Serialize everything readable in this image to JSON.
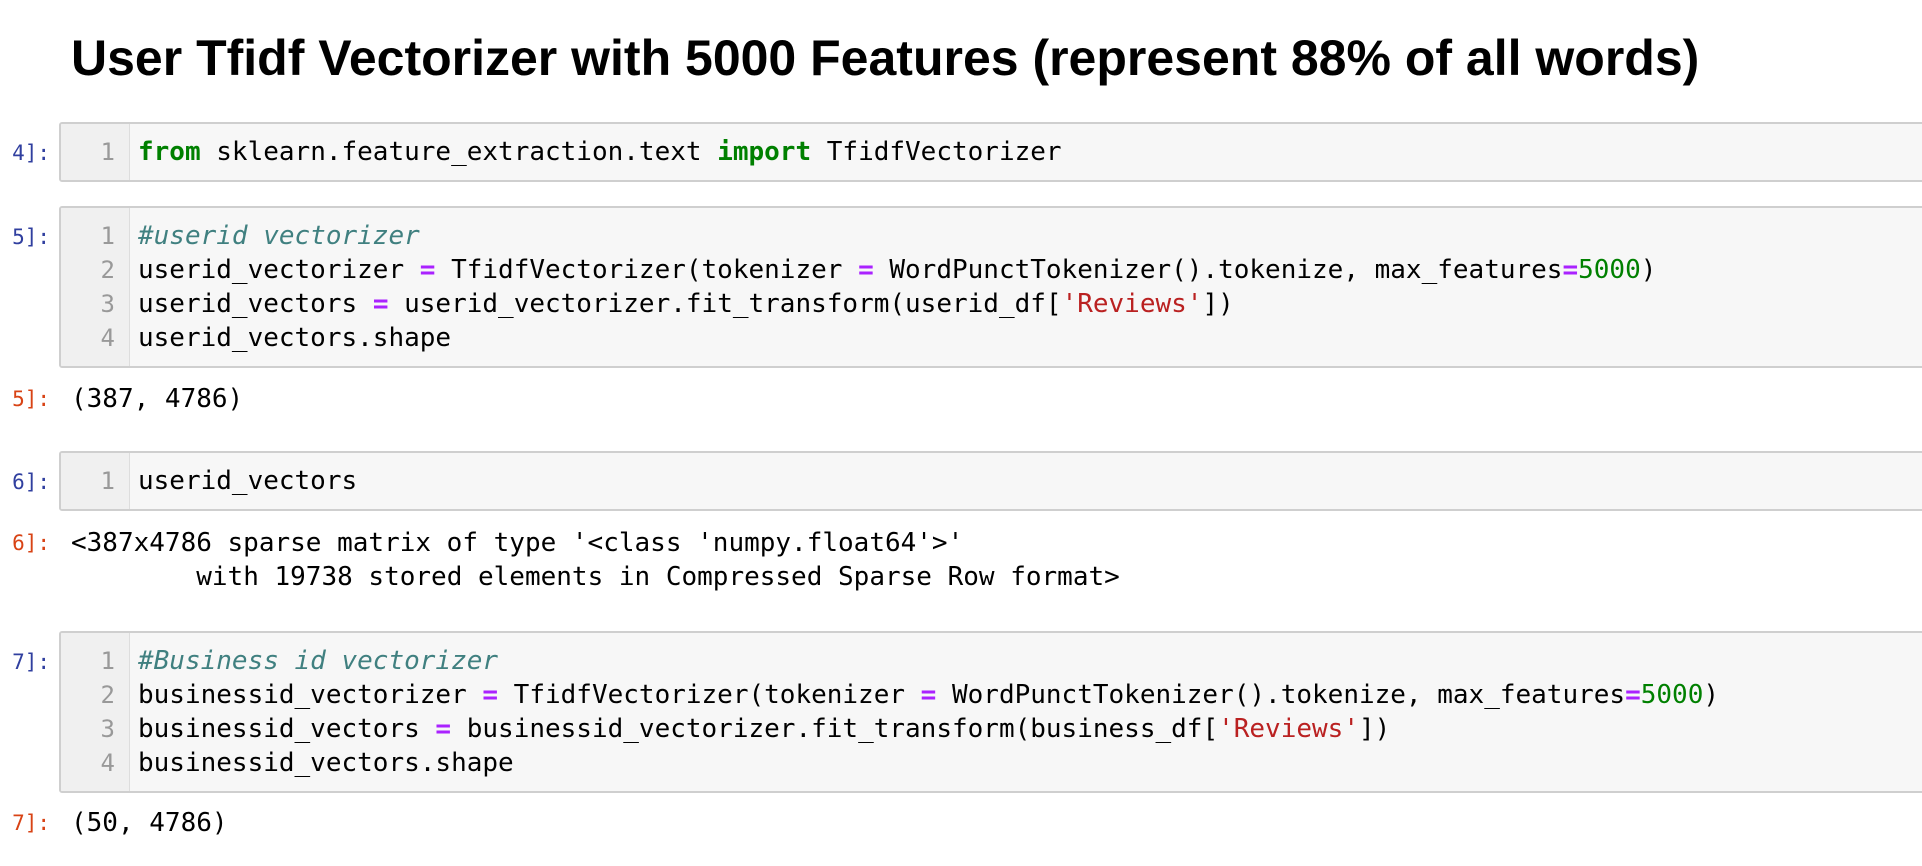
{
  "heading": "User Tfidf Vectorizer with 5000 Features (represent 88% of all words)",
  "cells": [
    {
      "in_prompt": "4]:",
      "lines": [
        {
          "n": "1",
          "tokens": [
            {
              "t": "from",
              "c": "kw"
            },
            {
              "t": " sklearn.feature_extraction.text ",
              "c": ""
            },
            {
              "t": "import",
              "c": "kw"
            },
            {
              "t": " TfidfVectorizer",
              "c": ""
            }
          ]
        }
      ]
    },
    {
      "in_prompt": "5]:",
      "lines": [
        {
          "n": "1",
          "tokens": [
            {
              "t": "#userid vectorizer",
              "c": "cm"
            }
          ]
        },
        {
          "n": "2",
          "tokens": [
            {
              "t": "userid_vectorizer ",
              "c": ""
            },
            {
              "t": "=",
              "c": "op"
            },
            {
              "t": " TfidfVectorizer(tokenizer ",
              "c": ""
            },
            {
              "t": "=",
              "c": "op"
            },
            {
              "t": " WordPunctTokenizer().tokenize, max_features",
              "c": ""
            },
            {
              "t": "=",
              "c": "op"
            },
            {
              "t": "5000",
              "c": "num"
            },
            {
              "t": ")",
              "c": ""
            }
          ]
        },
        {
          "n": "3",
          "tokens": [
            {
              "t": "userid_vectors ",
              "c": ""
            },
            {
              "t": "=",
              "c": "op"
            },
            {
              "t": " userid_vectorizer.fit_transform(userid_df[",
              "c": ""
            },
            {
              "t": "'Reviews'",
              "c": "str"
            },
            {
              "t": "])",
              "c": ""
            }
          ]
        },
        {
          "n": "4",
          "tokens": [
            {
              "t": "userid_vectors.shape",
              "c": ""
            }
          ]
        }
      ],
      "out_prompt": "5]:",
      "output": "(387, 4786)"
    },
    {
      "in_prompt": "6]:",
      "lines": [
        {
          "n": "1",
          "tokens": [
            {
              "t": "userid_vectors",
              "c": ""
            }
          ]
        }
      ],
      "out_prompt": "6]:",
      "output": "<387x4786 sparse matrix of type '<class 'numpy.float64'>'\n\twith 19738 stored elements in Compressed Sparse Row format>"
    },
    {
      "in_prompt": "7]:",
      "lines": [
        {
          "n": "1",
          "tokens": [
            {
              "t": "#Business id vectorizer",
              "c": "cm"
            }
          ]
        },
        {
          "n": "2",
          "tokens": [
            {
              "t": "businessid_vectorizer ",
              "c": ""
            },
            {
              "t": "=",
              "c": "op"
            },
            {
              "t": " TfidfVectorizer(tokenizer ",
              "c": ""
            },
            {
              "t": "=",
              "c": "op"
            },
            {
              "t": " WordPunctTokenizer().tokenize, max_features",
              "c": ""
            },
            {
              "t": "=",
              "c": "op"
            },
            {
              "t": "5000",
              "c": "num"
            },
            {
              "t": ")",
              "c": ""
            }
          ]
        },
        {
          "n": "3",
          "tokens": [
            {
              "t": "businessid_vectors ",
              "c": ""
            },
            {
              "t": "=",
              "c": "op"
            },
            {
              "t": " businessid_vectorizer.fit_transform(business_df[",
              "c": ""
            },
            {
              "t": "'Reviews'",
              "c": "str"
            },
            {
              "t": "])",
              "c": ""
            }
          ]
        },
        {
          "n": "4",
          "tokens": [
            {
              "t": "businessid_vectors.shape",
              "c": ""
            }
          ]
        }
      ],
      "out_prompt": "7]:",
      "output": "(50, 4786)"
    }
  ],
  "colors": {
    "keyword": "#008000",
    "operator": "#aa22ff",
    "comment": "#408080",
    "string": "#ba2121",
    "number": "#008000",
    "in_prompt": "#303f9f",
    "out_prompt": "#d84315"
  }
}
